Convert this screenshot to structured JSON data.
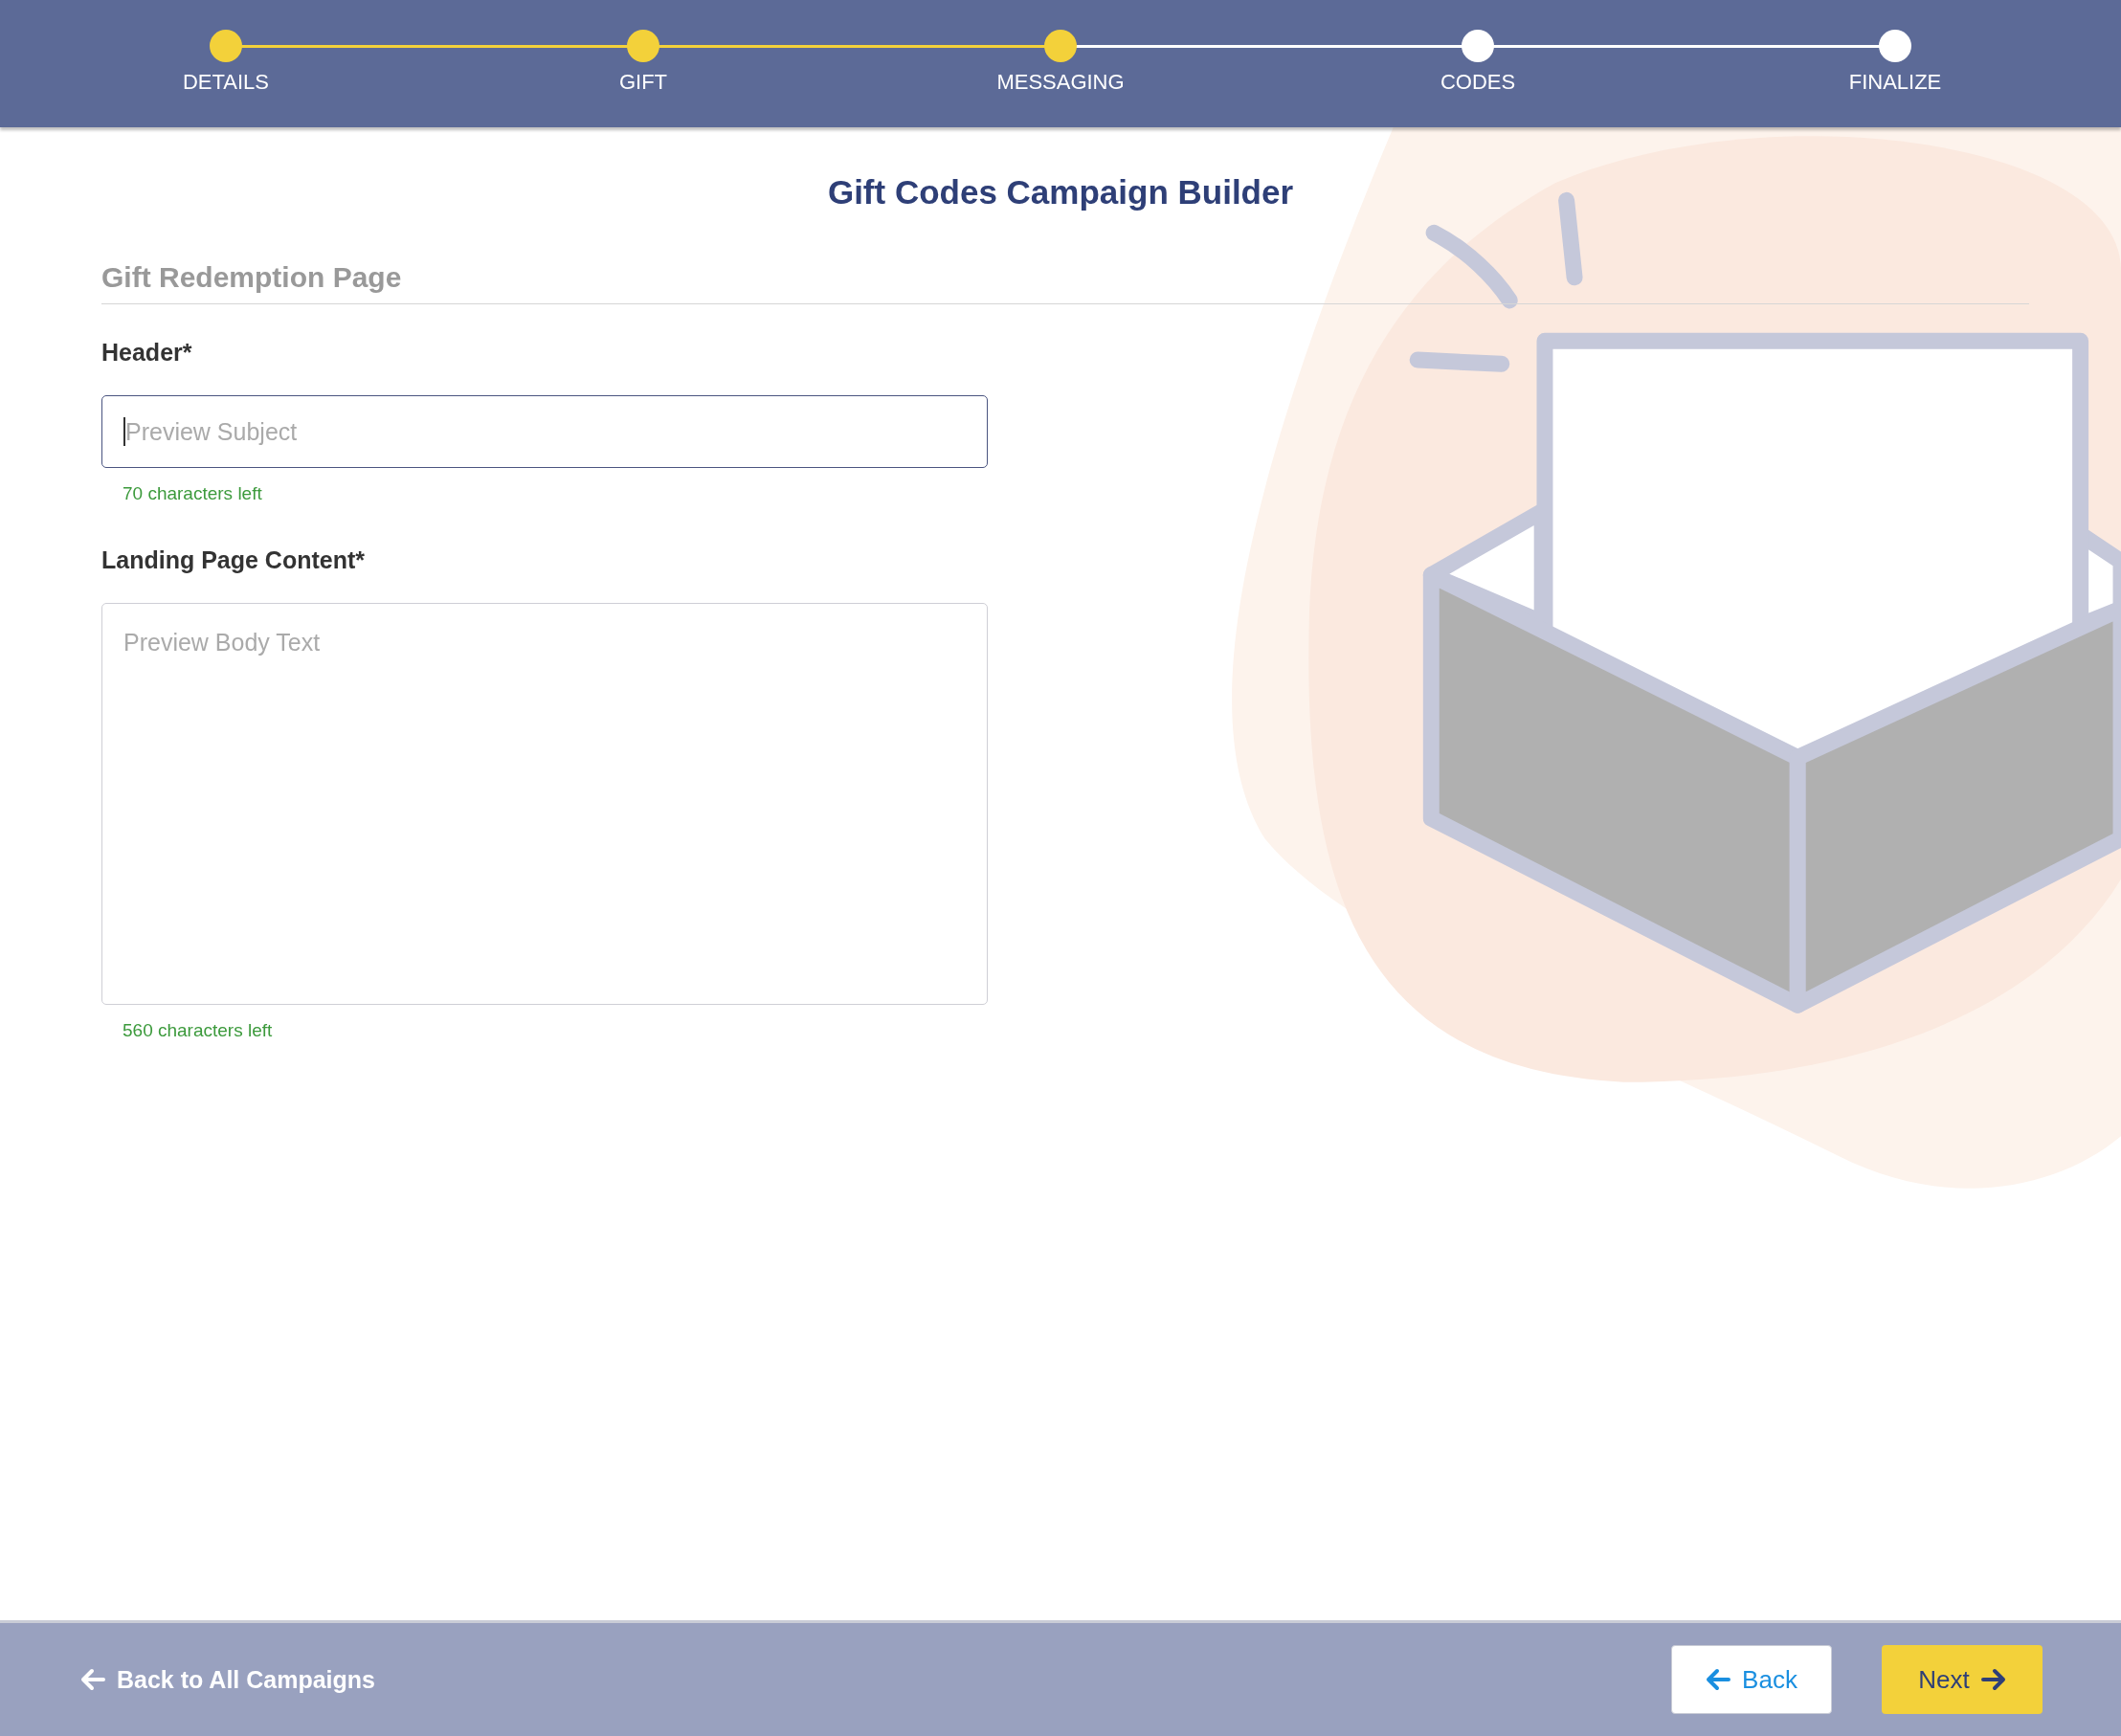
{
  "steps": [
    {
      "label": "DETAILS",
      "done": true
    },
    {
      "label": "GIFT",
      "done": true
    },
    {
      "label": "MESSAGING",
      "done": true
    },
    {
      "label": "CODES",
      "done": false
    },
    {
      "label": "FINALIZE",
      "done": false
    }
  ],
  "title": "Gift Codes Campaign Builder",
  "section": "Gift Redemption Page",
  "fields": [
    {
      "kind": "input",
      "label": "Header*",
      "placeholder": "Preview Subject",
      "focused": true,
      "counter": "70 characters left"
    },
    {
      "kind": "textarea",
      "label": "Landing Page Content*",
      "placeholder": "Preview Body Text",
      "focused": false,
      "counter": "560 characters left"
    }
  ],
  "footer": {
    "back_link": "Back to All Campaigns",
    "back_button": "Back",
    "next_button": "Next"
  }
}
